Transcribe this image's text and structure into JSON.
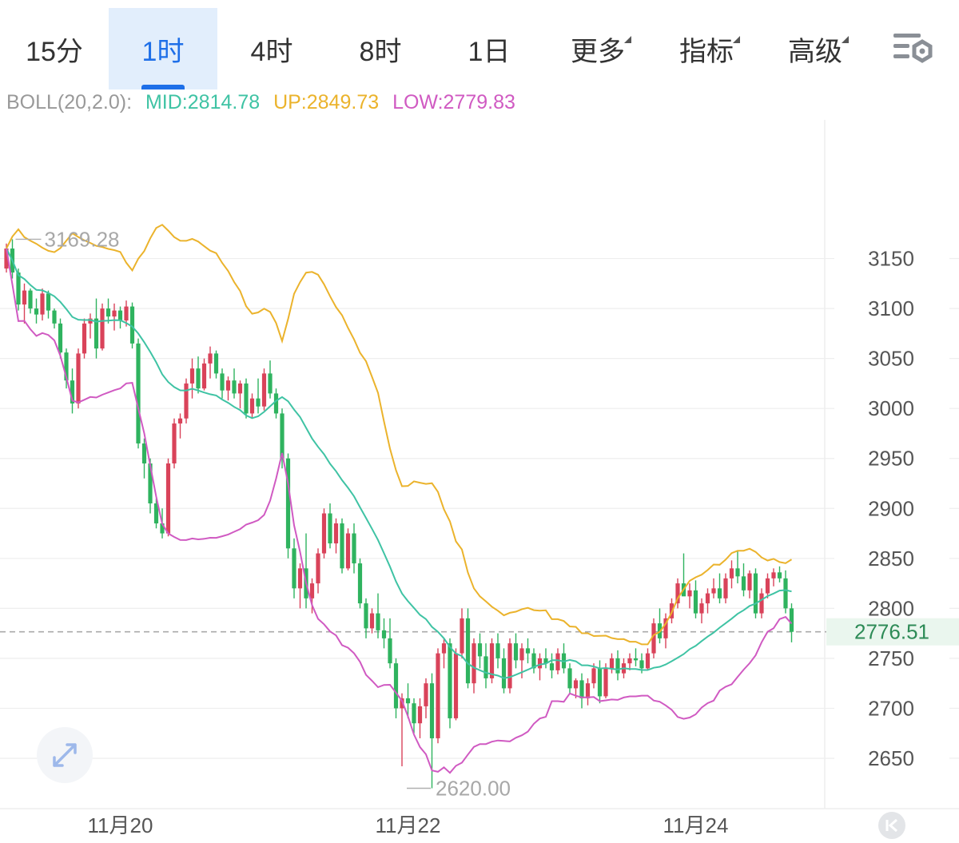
{
  "tabs": [
    {
      "label": "15分",
      "active": false,
      "dropdown": false
    },
    {
      "label": "1时",
      "active": true,
      "dropdown": false
    },
    {
      "label": "4时",
      "active": false,
      "dropdown": false
    },
    {
      "label": "8时",
      "active": false,
      "dropdown": false
    },
    {
      "label": "1日",
      "active": false,
      "dropdown": false
    },
    {
      "label": "更多",
      "active": false,
      "dropdown": true
    },
    {
      "label": "指标",
      "active": false,
      "dropdown": true
    },
    {
      "label": "高级",
      "active": false,
      "dropdown": true
    }
  ],
  "icons": {
    "settings": "indicator-settings-icon",
    "expand": "expand-arrows-icon",
    "scroll_back": "scroll-to-start-icon"
  },
  "legend": {
    "name": "BOLL(20,2.0):",
    "mid": "MID:2814.78",
    "up": "UP:2849.73",
    "low": "LOW:2779.83"
  },
  "colors": {
    "accent": "#1e6fe8",
    "up_candle": "#d9435a",
    "down_candle": "#2fb35f",
    "mid_line": "#3fc3a4",
    "up_line": "#ebb32c",
    "low_line": "#d05ac2",
    "legend_name": "#999999",
    "grid": "#eeeeee",
    "last_price_bg": "#eaf6ee",
    "last_price_text": "#2e8b57"
  },
  "chart_data": {
    "type": "candlestick",
    "y_ticks": [
      3150,
      3100,
      3050,
      3000,
      2950,
      2900,
      2850,
      2800,
      2750,
      2700,
      2650
    ],
    "ylim": [
      2614,
      3220
    ],
    "x_labels": [
      {
        "label": "11月20",
        "index": 19
      },
      {
        "label": "11月22",
        "index": 67
      },
      {
        "label": "11月24",
        "index": 115
      }
    ],
    "last_price": 2776.51,
    "last_price_label": "2776.51",
    "high_mark": {
      "value": 3169.28,
      "label": "3169.28",
      "index": 1
    },
    "low_mark": {
      "value": 2620.0,
      "label": "2620.00",
      "index": 66
    },
    "candles": [
      [
        3140,
        3165,
        3136,
        3160
      ],
      [
        3160,
        3169.28,
        3130,
        3136
      ],
      [
        3136,
        3140,
        3098,
        3104
      ],
      [
        3104,
        3125,
        3085,
        3118
      ],
      [
        3118,
        3120,
        3095,
        3100
      ],
      [
        3100,
        3110,
        3085,
        3094
      ],
      [
        3094,
        3120,
        3088,
        3115
      ],
      [
        3115,
        3118,
        3090,
        3098
      ],
      [
        3098,
        3100,
        3080,
        3085
      ],
      [
        3085,
        3090,
        3050,
        3056
      ],
      [
        3056,
        3060,
        3020,
        3028
      ],
      [
        3028,
        3040,
        2995,
        3005
      ],
      [
        3005,
        3060,
        3000,
        3055
      ],
      [
        3055,
        3090,
        3050,
        3085
      ],
      [
        3085,
        3095,
        3070,
        3090
      ],
      [
        3090,
        3110,
        3050,
        3060
      ],
      [
        3060,
        3105,
        3058,
        3100
      ],
      [
        3100,
        3110,
        3085,
        3092
      ],
      [
        3092,
        3105,
        3078,
        3098
      ],
      [
        3098,
        3102,
        3080,
        3088
      ],
      [
        3088,
        3108,
        3082,
        3102
      ],
      [
        3102,
        3106,
        3060,
        3065
      ],
      [
        3065,
        3070,
        2960,
        2965
      ],
      [
        2965,
        2970,
        2930,
        2945
      ],
      [
        2945,
        2950,
        2895,
        2905
      ],
      [
        2905,
        2910,
        2880,
        2885
      ],
      [
        2885,
        2900,
        2870,
        2875
      ],
      [
        2875,
        2950,
        2872,
        2945
      ],
      [
        2945,
        2990,
        2940,
        2985
      ],
      [
        2985,
        2995,
        2970,
        2990
      ],
      [
        2990,
        3030,
        2985,
        3025
      ],
      [
        3025,
        3050,
        3010,
        3040
      ],
      [
        3040,
        3052,
        3015,
        3020
      ],
      [
        3020,
        3050,
        3018,
        3045
      ],
      [
        3045,
        3062,
        3030,
        3055
      ],
      [
        3055,
        3058,
        3030,
        3035
      ],
      [
        3035,
        3040,
        3010,
        3018
      ],
      [
        3018,
        3032,
        3008,
        3028
      ],
      [
        3028,
        3040,
        3010,
        3015
      ],
      [
        3015,
        3028,
        3000,
        3025
      ],
      [
        3025,
        3030,
        2990,
        2995
      ],
      [
        2995,
        3015,
        2990,
        3010
      ],
      [
        3010,
        3030,
        2995,
        3002
      ],
      [
        3002,
        3040,
        2998,
        3035
      ],
      [
        3035,
        3048,
        3010,
        3015
      ],
      [
        3015,
        3020,
        2990,
        2995
      ],
      [
        2995,
        3000,
        2940,
        2950
      ],
      [
        2950,
        2955,
        2850,
        2860
      ],
      [
        2860,
        2870,
        2810,
        2820
      ],
      [
        2820,
        2845,
        2800,
        2840
      ],
      [
        2840,
        2875,
        2800,
        2810
      ],
      [
        2810,
        2830,
        2795,
        2825
      ],
      [
        2825,
        2860,
        2815,
        2855
      ],
      [
        2855,
        2900,
        2850,
        2895
      ],
      [
        2895,
        2905,
        2860,
        2865
      ],
      [
        2865,
        2890,
        2855,
        2885
      ],
      [
        2885,
        2890,
        2835,
        2840
      ],
      [
        2840,
        2880,
        2838,
        2875
      ],
      [
        2875,
        2885,
        2835,
        2845
      ],
      [
        2845,
        2850,
        2800,
        2805
      ],
      [
        2805,
        2810,
        2770,
        2780
      ],
      [
        2780,
        2800,
        2775,
        2795
      ],
      [
        2795,
        2815,
        2770,
        2778
      ],
      [
        2778,
        2790,
        2760,
        2770
      ],
      [
        2770,
        2790,
        2740,
        2745
      ],
      [
        2745,
        2750,
        2690,
        2700
      ],
      [
        2700,
        2715,
        2642,
        2710
      ],
      [
        2710,
        2725,
        2690,
        2705
      ],
      [
        2705,
        2710,
        2675,
        2685
      ],
      [
        2685,
        2710,
        2670,
        2702
      ],
      [
        2702,
        2730,
        2690,
        2725
      ],
      [
        2725,
        2735,
        2620,
        2670
      ],
      [
        2670,
        2760,
        2665,
        2755
      ],
      [
        2755,
        2770,
        2740,
        2765
      ],
      [
        2765,
        2770,
        2680,
        2690
      ],
      [
        2690,
        2760,
        2688,
        2755
      ],
      [
        2755,
        2800,
        2750,
        2790
      ],
      [
        2790,
        2800,
        2720,
        2725
      ],
      [
        2725,
        2770,
        2715,
        2765
      ],
      [
        2765,
        2775,
        2740,
        2752
      ],
      [
        2752,
        2765,
        2720,
        2730
      ],
      [
        2730,
        2770,
        2725,
        2765
      ],
      [
        2765,
        2775,
        2740,
        2750
      ],
      [
        2750,
        2760,
        2715,
        2720
      ],
      [
        2720,
        2770,
        2715,
        2765
      ],
      [
        2765,
        2775,
        2740,
        2748
      ],
      [
        2748,
        2765,
        2730,
        2760
      ],
      [
        2760,
        2770,
        2745,
        2755
      ],
      [
        2755,
        2760,
        2735,
        2740
      ],
      [
        2740,
        2755,
        2728,
        2750
      ],
      [
        2750,
        2760,
        2740,
        2745
      ],
      [
        2745,
        2755,
        2730,
        2738
      ],
      [
        2738,
        2760,
        2734,
        2755
      ],
      [
        2755,
        2765,
        2735,
        2740
      ],
      [
        2740,
        2745,
        2715,
        2720
      ],
      [
        2720,
        2730,
        2710,
        2728
      ],
      [
        2728,
        2735,
        2700,
        2710
      ],
      [
        2710,
        2730,
        2703,
        2725
      ],
      [
        2725,
        2745,
        2720,
        2740
      ],
      [
        2740,
        2748,
        2705,
        2712
      ],
      [
        2712,
        2745,
        2710,
        2740
      ],
      [
        2740,
        2755,
        2735,
        2750
      ],
      [
        2750,
        2758,
        2728,
        2735
      ],
      [
        2735,
        2750,
        2730,
        2745
      ],
      [
        2745,
        2755,
        2738,
        2750
      ],
      [
        2750,
        2760,
        2742,
        2748
      ],
      [
        2748,
        2755,
        2735,
        2740
      ],
      [
        2740,
        2760,
        2738,
        2755
      ],
      [
        2755,
        2790,
        2750,
        2785
      ],
      [
        2785,
        2800,
        2765,
        2770
      ],
      [
        2770,
        2795,
        2760,
        2790
      ],
      [
        2790,
        2810,
        2785,
        2805
      ],
      [
        2805,
        2830,
        2800,
        2825
      ],
      [
        2825,
        2855,
        2820,
        2812
      ],
      [
        2812,
        2825,
        2800,
        2818
      ],
      [
        2818,
        2828,
        2790,
        2795
      ],
      [
        2795,
        2810,
        2785,
        2805
      ],
      [
        2805,
        2820,
        2795,
        2815
      ],
      [
        2815,
        2830,
        2810,
        2820
      ],
      [
        2820,
        2835,
        2805,
        2810
      ],
      [
        2810,
        2835,
        2805,
        2830
      ],
      [
        2830,
        2848,
        2820,
        2840
      ],
      [
        2840,
        2858,
        2825,
        2832
      ],
      [
        2832,
        2845,
        2812,
        2818
      ],
      [
        2818,
        2838,
        2810,
        2835
      ],
      [
        2835,
        2840,
        2790,
        2795
      ],
      [
        2795,
        2820,
        2790,
        2815
      ],
      [
        2815,
        2835,
        2810,
        2830
      ],
      [
        2830,
        2840,
        2822,
        2836
      ],
      [
        2836,
        2842,
        2826,
        2830
      ],
      [
        2830,
        2838,
        2795,
        2800
      ],
      [
        2800,
        2805,
        2766,
        2776.51
      ]
    ]
  }
}
